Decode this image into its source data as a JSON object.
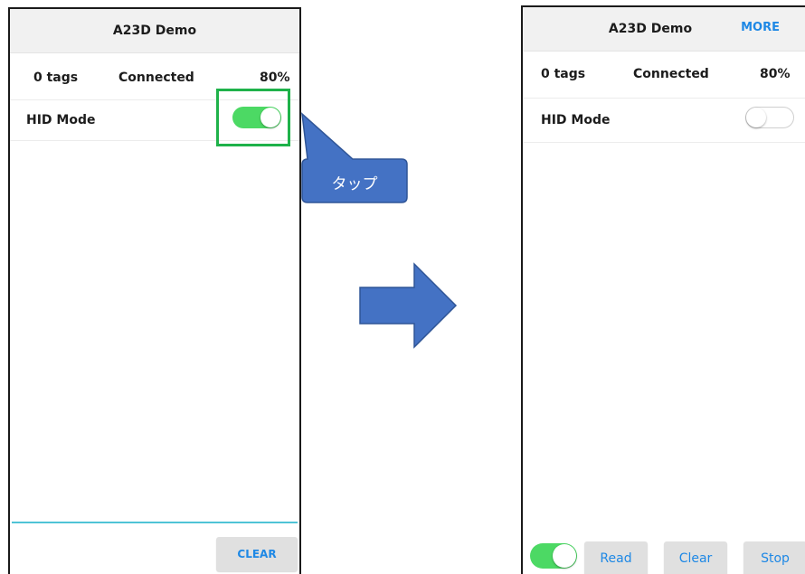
{
  "left_screen": {
    "title": "A23D Demo",
    "status": {
      "tags": "0 tags",
      "connection": "Connected",
      "battery": "80%"
    },
    "hid_mode": {
      "label": "HID Mode",
      "state": "on"
    },
    "clear_button": "CLEAR"
  },
  "right_screen": {
    "title": "A23D Demo",
    "more_label": "MORE",
    "status": {
      "tags": "0 tags",
      "connection": "Connected",
      "battery": "80%"
    },
    "hid_mode": {
      "label": "HID Mode",
      "state": "off"
    },
    "bottom_toggle": {
      "state": "on"
    },
    "buttons": {
      "read": "Read",
      "clear": "Clear",
      "stop": "Stop"
    }
  },
  "callout": {
    "text": "タップ"
  },
  "colors": {
    "switch_on": "#4cd964",
    "highlight": "#1fb24a",
    "accent_blue": "#1e88e5",
    "divider": "#4fc3d6",
    "callout_fill": "#4472c4"
  },
  "icons": {
    "arrow": "right-arrow-icon"
  }
}
